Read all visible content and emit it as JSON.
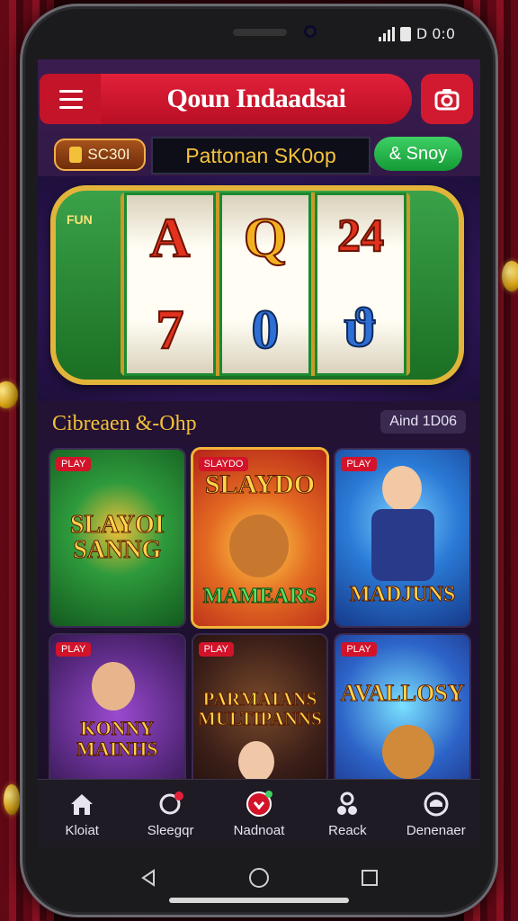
{
  "status": {
    "time": "D 0:0"
  },
  "header": {
    "title": "Qoun Indaadsai",
    "menu_icon": "hamburger-icon",
    "camera_icon": "camera-icon"
  },
  "promo": {
    "coins": "SC30I",
    "banner": "Pattonan SK0op",
    "shop_label": "& Snoy"
  },
  "slot": {
    "reels": [
      [
        "A",
        "7"
      ],
      [
        "Q",
        "0"
      ],
      [
        "24",
        "ϑ"
      ]
    ],
    "left_label": "FUN",
    "colors": {
      "frame": "#e2b43a",
      "body": "#3ba34a",
      "reel": "#fffdf4"
    }
  },
  "section": {
    "title": "Cibreaen &-Ohp",
    "link": "Aind 1D06"
  },
  "games": [
    {
      "name": "SLAYOI SANNG",
      "tag": "PLAY",
      "bg": "#1e7a2c"
    },
    {
      "name": "MAMEARS",
      "tag": "SLAYDO",
      "bg": "#d0421a",
      "title2": "SLAYDO"
    },
    {
      "name": "MADJUNS",
      "tag": "PLAY",
      "bg": "#1f5bb8"
    },
    {
      "name": "KONNY MAINHS",
      "tag": "PLAY",
      "bg": "#5a2a82"
    },
    {
      "name": "PARMAIANS MULTIPANNS",
      "tag": "PLAY",
      "bg": "#3a1e18"
    },
    {
      "name": "AVALLOSY",
      "tag": "PLAY",
      "bg": "#2d64c8"
    }
  ],
  "nav": [
    {
      "label": "Kloiat",
      "icon": "home-icon"
    },
    {
      "label": "Sleegqr",
      "icon": "chat-icon"
    },
    {
      "label": "Nadnoat",
      "icon": "record-icon"
    },
    {
      "label": "Reack",
      "icon": "people-icon"
    },
    {
      "label": "Denenaer",
      "icon": "profile-icon"
    }
  ]
}
